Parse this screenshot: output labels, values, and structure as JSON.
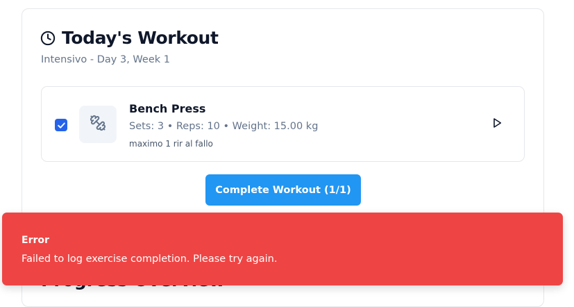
{
  "workout": {
    "title": "Today's Workout",
    "subtitle": "Intensivo - Day 3, Week 1",
    "title_icon": "clock-icon"
  },
  "exercises": [
    {
      "name": "Bench Press",
      "detail": "Sets: 3 • Reps: 10 • Weight: 15.00 kg",
      "note": "maximo 1 rir al fallo",
      "checked": true,
      "icon": "dumbbell-icon",
      "action_icon": "play-icon"
    }
  ],
  "complete_button": {
    "label": "Complete Workout (1/1)"
  },
  "next_section": {
    "heading": "Progress Overview"
  },
  "toast": {
    "title": "Error",
    "message": "Failed to log exercise completion. Please try again."
  },
  "colors": {
    "accent": "#2196f3",
    "checkbox": "#2563eb",
    "error": "#ef4444",
    "muted_text": "#64748b"
  }
}
